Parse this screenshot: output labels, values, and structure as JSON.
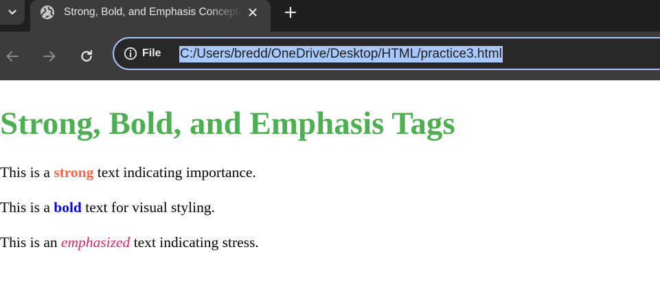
{
  "browser": {
    "tab": {
      "title": "Strong, Bold, and Emphasis Concepts",
      "favicon": "globe-icon"
    },
    "toolbar": {
      "back_icon": "back-arrow-icon",
      "forward_icon": "forward-arrow-icon",
      "reload_icon": "reload-icon"
    },
    "address_bar": {
      "site_chip_label": "File",
      "site_chip_icon": "info-icon",
      "url": "C:/Users/bredd/OneDrive/Desktop/HTML/practice3.html"
    },
    "colors": {
      "tabstrip_bg": "#1f1f1f",
      "toolbar_bg": "#3c3c3c",
      "omnibox_border": "#a8c7fa",
      "url_selection": "#a8c7fa"
    }
  },
  "page": {
    "heading": "Strong, Bold, and Emphasis Tags",
    "heading_color": "#4caf50",
    "paragraphs": [
      {
        "prefix": "This is a ",
        "highlight": "strong",
        "suffix": " text indicating importance.",
        "highlight_color": "#ff6347"
      },
      {
        "prefix": "This is a ",
        "highlight": "bold",
        "suffix": " text for visual styling.",
        "highlight_color": "#0000ff"
      },
      {
        "prefix": "This is an ",
        "highlight": "emphasized",
        "suffix": " text indicating stress.",
        "highlight_color": "#e91e63"
      }
    ]
  }
}
